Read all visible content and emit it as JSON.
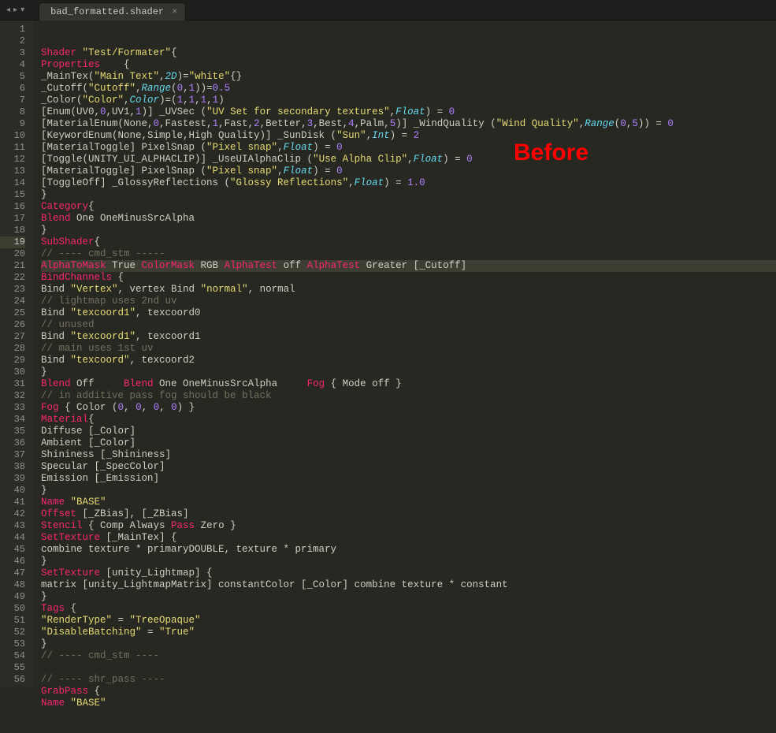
{
  "tab": {
    "title": "bad_formatted.shader",
    "close": "×"
  },
  "overlay": "Before",
  "nav": {
    "back": "◂",
    "fwd": "▸",
    "menu": "▾"
  },
  "lines": [
    {
      "n": 1,
      "tokens": [
        [
          "kw1",
          "Shader"
        ],
        [
          "pl",
          " "
        ],
        [
          "str",
          "\"Test/Formater\""
        ],
        [
          "pl",
          "{"
        ]
      ]
    },
    {
      "n": 2,
      "tokens": [
        [
          "kw1",
          "Properties"
        ],
        [
          "pl",
          "    {"
        ]
      ]
    },
    {
      "n": 3,
      "tokens": [
        [
          "pl",
          "_MainTex("
        ],
        [
          "str",
          "\"Main Text\""
        ],
        [
          "pl",
          ","
        ],
        [
          "kw2",
          "2D"
        ],
        [
          "pl",
          ")="
        ],
        [
          "str",
          "\"white\""
        ],
        [
          "pl",
          "{}"
        ]
      ]
    },
    {
      "n": 4,
      "tokens": [
        [
          "pl",
          "_Cutoff("
        ],
        [
          "str",
          "\"Cutoff\""
        ],
        [
          "pl",
          ","
        ],
        [
          "kw2",
          "Range"
        ],
        [
          "pl",
          "("
        ],
        [
          "num",
          "0"
        ],
        [
          "pl",
          ","
        ],
        [
          "num",
          "1"
        ],
        [
          "pl",
          "))="
        ],
        [
          "num",
          "0.5"
        ]
      ]
    },
    {
      "n": 5,
      "tokens": [
        [
          "pl",
          "_Color("
        ],
        [
          "str",
          "\"Color\""
        ],
        [
          "pl",
          ","
        ],
        [
          "kw2",
          "Color"
        ],
        [
          "pl",
          ")=("
        ],
        [
          "num",
          "1"
        ],
        [
          "pl",
          ","
        ],
        [
          "num",
          "1"
        ],
        [
          "pl",
          ","
        ],
        [
          "num",
          "1"
        ],
        [
          "pl",
          ","
        ],
        [
          "num",
          "1"
        ],
        [
          "pl",
          ")"
        ]
      ]
    },
    {
      "n": 6,
      "tokens": [
        [
          "pl",
          "[Enum(UV0,"
        ],
        [
          "num",
          "0"
        ],
        [
          "pl",
          ",UV1,"
        ],
        [
          "num",
          "1"
        ],
        [
          "pl",
          ")] _UVSec ("
        ],
        [
          "str",
          "\"UV Set for secondary textures\""
        ],
        [
          "pl",
          ","
        ],
        [
          "kw2",
          "Float"
        ],
        [
          "pl",
          ") = "
        ],
        [
          "num",
          "0"
        ]
      ]
    },
    {
      "n": 7,
      "tokens": [
        [
          "pl",
          "[MaterialEnum(None,"
        ],
        [
          "num",
          "0"
        ],
        [
          "pl",
          ",Fastest,"
        ],
        [
          "num",
          "1"
        ],
        [
          "pl",
          ",Fast,"
        ],
        [
          "num",
          "2"
        ],
        [
          "pl",
          ",Better,"
        ],
        [
          "num",
          "3"
        ],
        [
          "pl",
          ",Best,"
        ],
        [
          "num",
          "4"
        ],
        [
          "pl",
          ",Palm,"
        ],
        [
          "num",
          "5"
        ],
        [
          "pl",
          ")] _WindQuality ("
        ],
        [
          "str",
          "\"Wind Quality\""
        ],
        [
          "pl",
          ","
        ],
        [
          "kw2",
          "Range"
        ],
        [
          "pl",
          "("
        ],
        [
          "num",
          "0"
        ],
        [
          "pl",
          ","
        ],
        [
          "num",
          "5"
        ],
        [
          "pl",
          ")) = "
        ],
        [
          "num",
          "0"
        ]
      ]
    },
    {
      "n": 8,
      "tokens": [
        [
          "pl",
          "[KeywordEnum(None,Simple,High Quality)] _SunDisk ("
        ],
        [
          "str",
          "\"Sun\""
        ],
        [
          "pl",
          ","
        ],
        [
          "kw2",
          "Int"
        ],
        [
          "pl",
          ") = "
        ],
        [
          "num",
          "2"
        ]
      ]
    },
    {
      "n": 9,
      "tokens": [
        [
          "pl",
          "[MaterialToggle] PixelSnap ("
        ],
        [
          "str",
          "\"Pixel snap\""
        ],
        [
          "pl",
          ","
        ],
        [
          "kw2",
          "Float"
        ],
        [
          "pl",
          ") = "
        ],
        [
          "num",
          "0"
        ]
      ]
    },
    {
      "n": 10,
      "tokens": [
        [
          "pl",
          "[Toggle(UNITY_UI_ALPHACLIP)] _UseUIAlphaClip ("
        ],
        [
          "str",
          "\"Use Alpha Clip\""
        ],
        [
          "pl",
          ","
        ],
        [
          "kw2",
          "Float"
        ],
        [
          "pl",
          ") = "
        ],
        [
          "num",
          "0"
        ]
      ]
    },
    {
      "n": 11,
      "tokens": [
        [
          "pl",
          "[MaterialToggle] PixelSnap ("
        ],
        [
          "str",
          "\"Pixel snap\""
        ],
        [
          "pl",
          ","
        ],
        [
          "kw2",
          "Float"
        ],
        [
          "pl",
          ") = "
        ],
        [
          "num",
          "0"
        ]
      ]
    },
    {
      "n": 12,
      "tokens": [
        [
          "pl",
          "[ToggleOff] _GlossyReflections ("
        ],
        [
          "str",
          "\"Glossy Reflections\""
        ],
        [
          "pl",
          ","
        ],
        [
          "kw2",
          "Float"
        ],
        [
          "pl",
          ") = "
        ],
        [
          "num",
          "1.0"
        ]
      ]
    },
    {
      "n": 13,
      "tokens": [
        [
          "pl",
          "}"
        ]
      ]
    },
    {
      "n": 14,
      "tokens": [
        [
          "kw1",
          "Category"
        ],
        [
          "pl",
          "{"
        ]
      ]
    },
    {
      "n": 15,
      "tokens": [
        [
          "kw1",
          "Blend"
        ],
        [
          "pl",
          " One OneMinusSrcAlpha"
        ]
      ]
    },
    {
      "n": 16,
      "tokens": [
        [
          "pl",
          "}"
        ]
      ]
    },
    {
      "n": 17,
      "tokens": [
        [
          "kw1",
          "SubShader"
        ],
        [
          "pl",
          "{"
        ]
      ]
    },
    {
      "n": 18,
      "tokens": [
        [
          "cmt",
          "// ---- cmd_stm -----"
        ]
      ]
    },
    {
      "n": 19,
      "active": true,
      "tokens": [
        [
          "kw1",
          "AlphaToMask"
        ],
        [
          "pl",
          " True "
        ],
        [
          "kw1",
          "ColorMask"
        ],
        [
          "pl",
          " RGB "
        ],
        [
          "kw1",
          "AlphaTest"
        ],
        [
          "pl",
          " off "
        ],
        [
          "kw1",
          "AlphaTest"
        ],
        [
          "pl",
          " Greater [_Cutoff]"
        ]
      ]
    },
    {
      "n": 20,
      "tokens": [
        [
          "kw1",
          "BindChannels"
        ],
        [
          "pl",
          " {"
        ]
      ]
    },
    {
      "n": 21,
      "tokens": [
        [
          "pl",
          "Bind "
        ],
        [
          "str",
          "\"Vertex\""
        ],
        [
          "pl",
          ", vertex Bind "
        ],
        [
          "str",
          "\"normal\""
        ],
        [
          "pl",
          ", normal"
        ]
      ]
    },
    {
      "n": 22,
      "tokens": [
        [
          "cmt",
          "// lightmap uses 2nd uv"
        ]
      ]
    },
    {
      "n": 23,
      "tokens": [
        [
          "pl",
          "Bind "
        ],
        [
          "str",
          "\"texcoord1\""
        ],
        [
          "pl",
          ", texcoord0"
        ]
      ]
    },
    {
      "n": 24,
      "tokens": [
        [
          "cmt",
          "// unused"
        ]
      ]
    },
    {
      "n": 25,
      "tokens": [
        [
          "pl",
          "Bind "
        ],
        [
          "str",
          "\"texcoord1\""
        ],
        [
          "pl",
          ", texcoord1"
        ]
      ]
    },
    {
      "n": 26,
      "tokens": [
        [
          "cmt",
          "// main uses 1st uv"
        ]
      ]
    },
    {
      "n": 27,
      "tokens": [
        [
          "pl",
          "Bind "
        ],
        [
          "str",
          "\"texcoord\""
        ],
        [
          "pl",
          ", texcoord2"
        ]
      ]
    },
    {
      "n": 28,
      "tokens": [
        [
          "pl",
          "}"
        ]
      ]
    },
    {
      "n": 29,
      "tokens": [
        [
          "kw1",
          "Blend"
        ],
        [
          "pl",
          " Off     "
        ],
        [
          "kw1",
          "Blend"
        ],
        [
          "pl",
          " One OneMinusSrcAlpha     "
        ],
        [
          "kw1",
          "Fog"
        ],
        [
          "pl",
          " { Mode off }"
        ]
      ]
    },
    {
      "n": 30,
      "tokens": [
        [
          "cmt",
          "// in additive pass fog should be black"
        ]
      ]
    },
    {
      "n": 31,
      "tokens": [
        [
          "kw1",
          "Fog"
        ],
        [
          "pl",
          " { Color ("
        ],
        [
          "num",
          "0"
        ],
        [
          "pl",
          ", "
        ],
        [
          "num",
          "0"
        ],
        [
          "pl",
          ", "
        ],
        [
          "num",
          "0"
        ],
        [
          "pl",
          ", "
        ],
        [
          "num",
          "0"
        ],
        [
          "pl",
          ") }"
        ]
      ]
    },
    {
      "n": 32,
      "tokens": [
        [
          "kw1",
          "Material"
        ],
        [
          "pl",
          "{"
        ]
      ]
    },
    {
      "n": 33,
      "tokens": [
        [
          "pl",
          "Diffuse [_Color]"
        ]
      ]
    },
    {
      "n": 34,
      "tokens": [
        [
          "pl",
          "Ambient [_Color]"
        ]
      ]
    },
    {
      "n": 35,
      "tokens": [
        [
          "pl",
          "Shininess [_Shininess]"
        ]
      ]
    },
    {
      "n": 36,
      "tokens": [
        [
          "pl",
          "Specular [_SpecColor]"
        ]
      ]
    },
    {
      "n": 37,
      "tokens": [
        [
          "pl",
          "Emission [_Emission]"
        ]
      ]
    },
    {
      "n": 38,
      "tokens": [
        [
          "pl",
          "}"
        ]
      ]
    },
    {
      "n": 39,
      "tokens": [
        [
          "kw1",
          "Name"
        ],
        [
          "pl",
          " "
        ],
        [
          "str",
          "\"BASE\""
        ]
      ]
    },
    {
      "n": 40,
      "tokens": [
        [
          "kw1",
          "Offset"
        ],
        [
          "pl",
          " [_ZBias], [_ZBias]"
        ]
      ]
    },
    {
      "n": 41,
      "tokens": [
        [
          "kw1",
          "Stencil"
        ],
        [
          "pl",
          " { Comp Always "
        ],
        [
          "kw1",
          "Pass"
        ],
        [
          "pl",
          " Zero }"
        ]
      ]
    },
    {
      "n": 42,
      "tokens": [
        [
          "kw1",
          "SetTexture"
        ],
        [
          "pl",
          " [_MainTex] {"
        ]
      ]
    },
    {
      "n": 43,
      "tokens": [
        [
          "pl",
          "combine texture * primaryDOUBLE, texture * primary"
        ]
      ]
    },
    {
      "n": 44,
      "tokens": [
        [
          "pl",
          "}"
        ]
      ]
    },
    {
      "n": 45,
      "tokens": [
        [
          "kw1",
          "SetTexture"
        ],
        [
          "pl",
          " [unity_Lightmap] {"
        ]
      ]
    },
    {
      "n": 46,
      "tokens": [
        [
          "pl",
          "matrix [unity_LightmapMatrix] constantColor [_Color] combine texture * constant"
        ]
      ]
    },
    {
      "n": 47,
      "tokens": [
        [
          "pl",
          "}"
        ]
      ]
    },
    {
      "n": 48,
      "tokens": [
        [
          "kw1",
          "Tags"
        ],
        [
          "pl",
          " {"
        ]
      ]
    },
    {
      "n": 49,
      "tokens": [
        [
          "str",
          "\"RenderType\""
        ],
        [
          "pl",
          " = "
        ],
        [
          "str",
          "\"TreeOpaque\""
        ]
      ]
    },
    {
      "n": 50,
      "tokens": [
        [
          "str",
          "\"DisableBatching\""
        ],
        [
          "pl",
          " = "
        ],
        [
          "str",
          "\"True\""
        ]
      ]
    },
    {
      "n": 51,
      "tokens": [
        [
          "pl",
          "}"
        ]
      ]
    },
    {
      "n": 52,
      "tokens": [
        [
          "cmt",
          "// ---- cmd_stm ----"
        ]
      ]
    },
    {
      "n": 53,
      "tokens": [
        [
          "pl",
          ""
        ]
      ]
    },
    {
      "n": 54,
      "tokens": [
        [
          "cmt",
          "// ---- shr_pass ----"
        ]
      ]
    },
    {
      "n": 55,
      "tokens": [
        [
          "kw1",
          "GrabPass"
        ],
        [
          "pl",
          " {"
        ]
      ]
    },
    {
      "n": 56,
      "tokens": [
        [
          "kw1",
          "Name"
        ],
        [
          "pl",
          " "
        ],
        [
          "str",
          "\"BASE\""
        ]
      ]
    }
  ]
}
